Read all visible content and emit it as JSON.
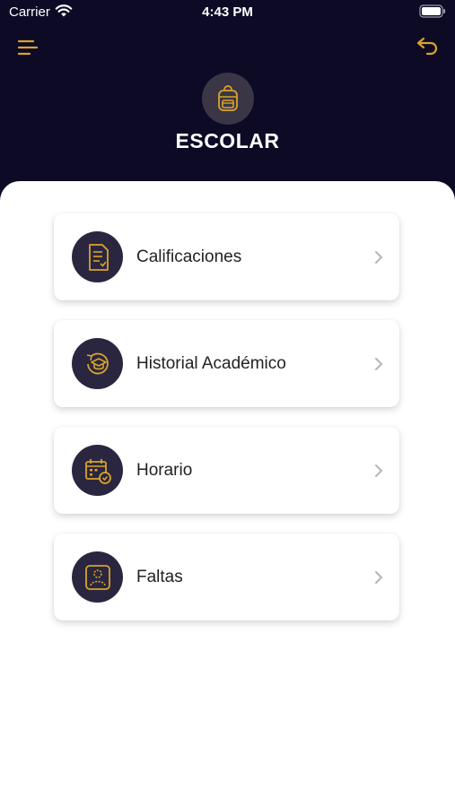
{
  "status_bar": {
    "carrier": "Carrier",
    "time": "4:43 PM"
  },
  "header": {
    "title": "ESCOLAR",
    "menu_icon": "menu-lines-icon",
    "back_icon": "undo-arrow-icon",
    "avatar_icon": "backpack-icon"
  },
  "colors": {
    "header_bg": "#0d0a26",
    "accent": "#d9a42a",
    "icon_circle": "#2a2640"
  },
  "menu": {
    "items": [
      {
        "label": "Calificaciones",
        "icon": "grades-document-icon"
      },
      {
        "label": "Historial Académico",
        "icon": "graduation-history-icon"
      },
      {
        "label": "Horario",
        "icon": "calendar-check-icon"
      },
      {
        "label": "Faltas",
        "icon": "person-absence-icon"
      }
    ]
  }
}
